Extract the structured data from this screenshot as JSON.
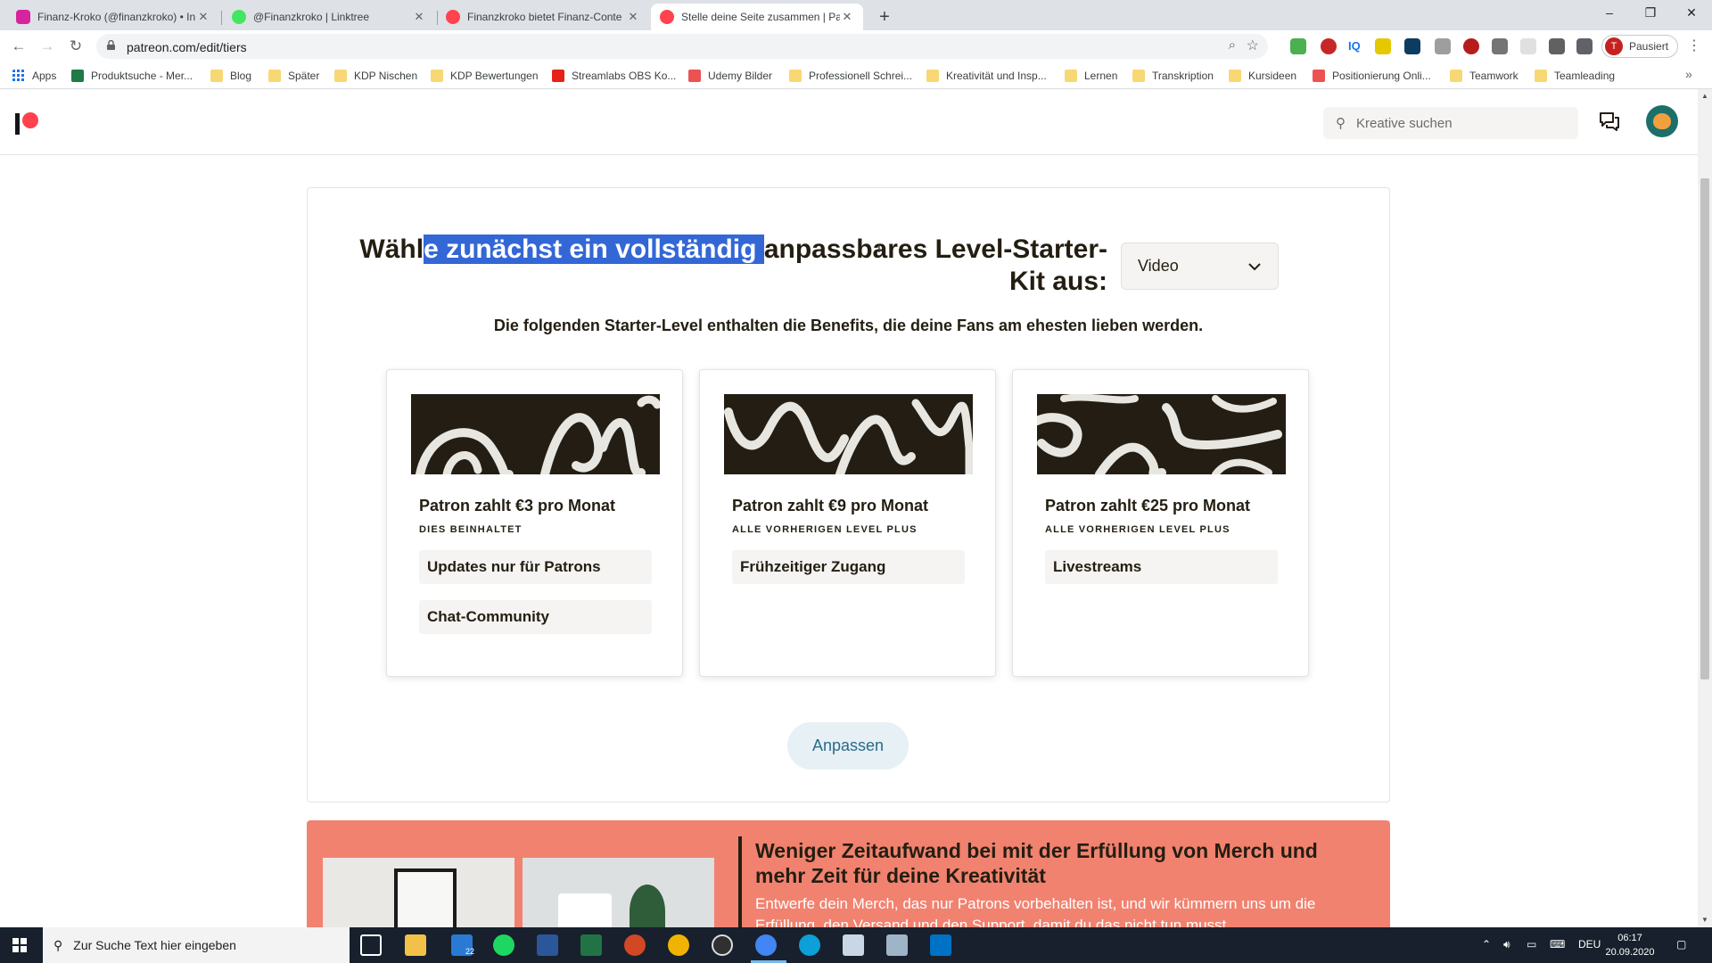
{
  "browser": {
    "tabs": [
      {
        "title": "Finanz-Kroko (@finanzkroko) • In",
        "icon": "instagram-icon",
        "color": "#d6249f",
        "active": false
      },
      {
        "title": "@Finanzkroko | Linktree",
        "icon": "linktree-icon",
        "color": "#43e660",
        "active": false
      },
      {
        "title": "Finanzkroko bietet Finanz-Conte",
        "icon": "patreon-icon",
        "color": "#ff424d",
        "active": false
      },
      {
        "title": "Stelle deine Seite zusammen | Pa",
        "icon": "patreon-icon",
        "color": "#ff424d",
        "active": true
      }
    ],
    "url": "patreon.com/edit/tiers",
    "profile_label": "Pausiert",
    "profile_initial": "T",
    "bookmarks": [
      {
        "label": "Apps",
        "icon": "apps-grid-icon"
      },
      {
        "label": "Produktsuche - Mer...",
        "icon": "produktsuche-icon"
      },
      {
        "label": "Blog",
        "icon": "folder-icon"
      },
      {
        "label": "Später",
        "icon": "folder-icon"
      },
      {
        "label": "KDP Nischen",
        "icon": "folder-icon"
      },
      {
        "label": "KDP Bewertungen",
        "icon": "folder-icon"
      },
      {
        "label": "Streamlabs OBS Ko...",
        "icon": "youtube-icon"
      },
      {
        "label": "Udemy Bilder",
        "icon": "udemy-icon"
      },
      {
        "label": "Professionell Schrei...",
        "icon": "folder-icon"
      },
      {
        "label": "Kreativität und Insp...",
        "icon": "folder-icon"
      },
      {
        "label": "Lernen",
        "icon": "folder-icon"
      },
      {
        "label": "Transkription",
        "icon": "folder-icon"
      },
      {
        "label": "Kursideen",
        "icon": "folder-icon"
      },
      {
        "label": "Positionierung Onli...",
        "icon": "udemy-icon"
      },
      {
        "label": "Teamwork",
        "icon": "folder-icon"
      },
      {
        "label": "Teamleading",
        "icon": "folder-icon"
      }
    ]
  },
  "header": {
    "search_placeholder": "Kreative suchen"
  },
  "main": {
    "heading_before": "Wähl",
    "heading_selected": "e zunächst ein vollständig ",
    "heading_after": "anpassbares Level-Starter-Kit aus:",
    "kit_select_value": "Video",
    "subheading": "Die folgenden Starter-Level enthalten die Benefits, die deine Fans am ehesten lieben werden.",
    "tiers": [
      {
        "price": "Patron zahlt €3 pro Monat",
        "includes": "DIES BEINHALTET",
        "benefits": [
          "Updates nur für Patrons",
          "Chat-Community"
        ]
      },
      {
        "price": "Patron zahlt €9 pro Monat",
        "includes": "ALLE VORHERIGEN LEVEL PLUS",
        "benefits": [
          "Frühzeitiger Zugang"
        ]
      },
      {
        "price": "Patron zahlt €25 pro Monat",
        "includes": "ALLE VORHERIGEN LEVEL PLUS",
        "benefits": [
          "Livestreams"
        ]
      }
    ],
    "customize_label": "Anpassen"
  },
  "promo": {
    "title": "Weniger Zeitaufwand bei mit der Erfüllung von Merch und mehr Zeit für deine Kreativität",
    "text": "Entwerfe dein Merch, das nur Patrons vorbehalten ist, und wir kümmern uns um die Erfüllung, den Versand und den Support, damit du das nicht tun musst."
  },
  "taskbar": {
    "search_placeholder": "Zur Suche Text hier eingeben",
    "mail_badge": "22",
    "language": "DEU",
    "time": "06:17",
    "date": "20.09.2020"
  },
  "colors": {
    "patreon_coral": "#ff424d",
    "selection": "#3367d6",
    "promo_bg": "#f1826f",
    "button_bg": "#e6f0f5"
  }
}
